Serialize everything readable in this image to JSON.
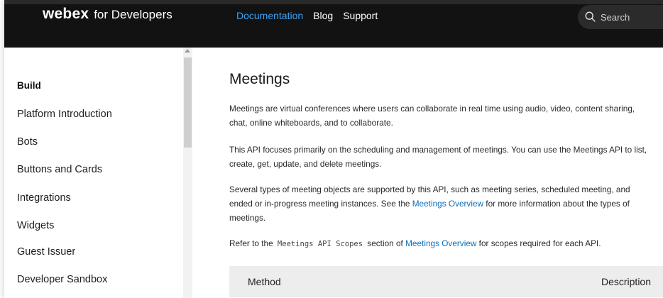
{
  "header": {
    "logo_main": "webex",
    "logo_sub": "for Developers",
    "nav": [
      {
        "label": "Documentation",
        "active": true
      },
      {
        "label": "Blog",
        "active": false
      },
      {
        "label": "Support",
        "active": false
      }
    ],
    "search": {
      "placeholder": "Search",
      "icon": "search-icon"
    }
  },
  "sidebar": {
    "heading": "Build",
    "items": [
      {
        "label": "Platform Introduction"
      },
      {
        "label": "Bots"
      },
      {
        "label": "Buttons and Cards"
      },
      {
        "label": "Integrations"
      },
      {
        "label": "Widgets"
      },
      {
        "label": "Guest Issuer"
      },
      {
        "label": "Developer Sandbox"
      }
    ]
  },
  "main": {
    "title": "Meetings",
    "p1": "Meetings are virtual conferences where users can collaborate in real time using audio, video, content sharing, chat, online whiteboards, and to collaborate.",
    "p2": "This API focuses primarily on the scheduling and management of meetings. You can use the Meetings API to list, create, get, update, and delete meetings.",
    "p3_before": "Several types of meeting objects are supported by this API, such as meeting series, scheduled meeting, and ended or in-progress meeting instances. See the ",
    "p3_link": "Meetings Overview",
    "p3_after": " for more information about the types of meetings.",
    "p4_before": "Refer to the ",
    "p4_code": "Meetings API Scopes",
    "p4_middle": " section of ",
    "p4_link": "Meetings Overview",
    "p4_after": " for scopes required for each API.",
    "table": {
      "col_method": "Method",
      "col_description": "Description"
    }
  },
  "colors": {
    "topbar": "#121212",
    "nav_active": "#3aa3f7",
    "link": "#0a6fbb"
  }
}
